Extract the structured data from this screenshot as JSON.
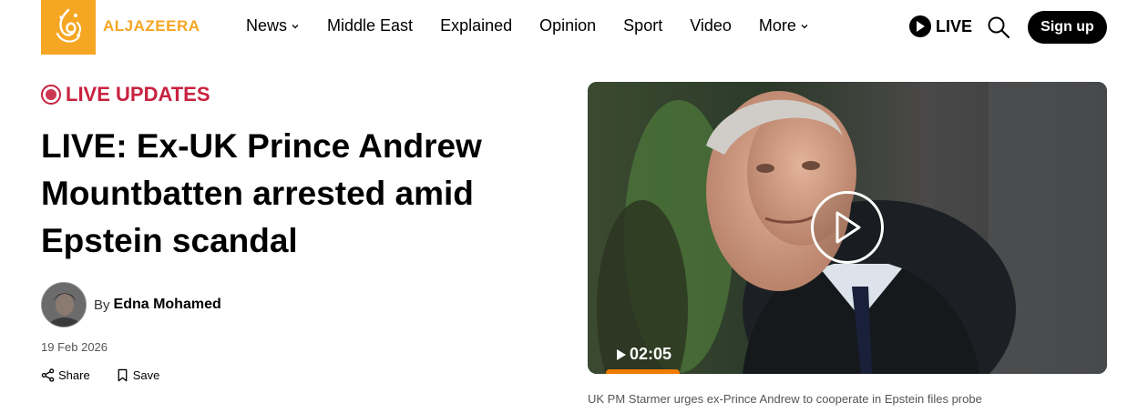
{
  "brand": {
    "name": "ALJAZEERA",
    "logo_icon": "aljazeera-logo-icon",
    "color": "#f5a623"
  },
  "nav": {
    "items": [
      {
        "label": "News",
        "dropdown": true
      },
      {
        "label": "Middle East",
        "dropdown": false
      },
      {
        "label": "Explained",
        "dropdown": false
      },
      {
        "label": "Opinion",
        "dropdown": false
      },
      {
        "label": "Sport",
        "dropdown": false
      },
      {
        "label": "Video",
        "dropdown": false
      },
      {
        "label": "More",
        "dropdown": true
      }
    ],
    "live_label": "LIVE",
    "signup_label": "Sign up"
  },
  "article": {
    "badge": "LIVE UPDATES",
    "badge_color": "#c8223f",
    "headline": "LIVE: Ex-UK Prince Andrew Mountbatten arrested amid Epstein scandal",
    "by_label": "By",
    "author": "Edna Mohamed",
    "date": "19 Feb 2026",
    "share_label": "Share",
    "save_label": "Save"
  },
  "video": {
    "duration": "02:05",
    "progress_color": "#f07c00",
    "caption": "UK PM Starmer urges ex-Prince Andrew to cooperate in Epstein files probe"
  }
}
